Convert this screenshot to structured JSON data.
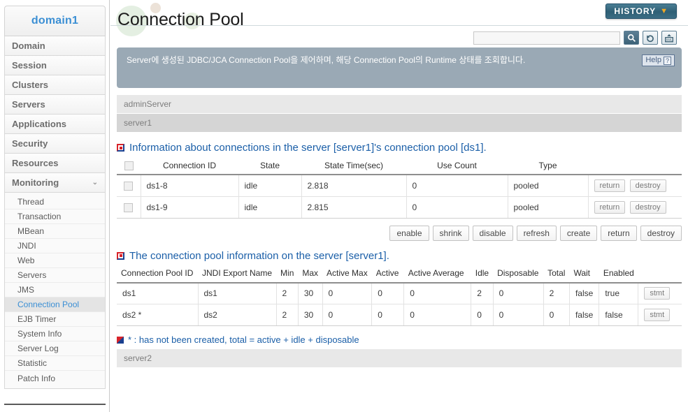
{
  "sidebar": {
    "brand": "domain1",
    "items": [
      {
        "label": "Domain"
      },
      {
        "label": "Session"
      },
      {
        "label": "Clusters"
      },
      {
        "label": "Servers"
      },
      {
        "label": "Applications"
      },
      {
        "label": "Security"
      },
      {
        "label": "Resources"
      },
      {
        "label": "Monitoring",
        "caret": "⌄",
        "expanded": true
      }
    ],
    "subitems": [
      {
        "label": "Thread",
        "active": false
      },
      {
        "label": "Transaction",
        "active": false
      },
      {
        "label": "MBean",
        "active": false
      },
      {
        "label": "JNDI",
        "active": false
      },
      {
        "label": "Web",
        "active": false
      },
      {
        "label": "Servers",
        "active": false
      },
      {
        "label": "JMS",
        "active": false
      },
      {
        "label": "Connection Pool",
        "active": true
      },
      {
        "label": "EJB Timer",
        "active": false
      },
      {
        "label": "System Info",
        "active": false
      },
      {
        "label": "Server Log",
        "active": false
      },
      {
        "label": "Statistic",
        "active": false
      },
      {
        "label": "Patch Info",
        "active": false
      }
    ]
  },
  "header": {
    "title": "Connection Pool",
    "history_label": "HISTORY",
    "history_caret": "▼",
    "search_value": "",
    "search_placeholder": "",
    "icons": [
      {
        "name": "search-icon",
        "glyph": "🔍"
      },
      {
        "name": "refresh-icon",
        "glyph": "↻"
      },
      {
        "name": "xml-export-icon",
        "glyph": "XML"
      }
    ]
  },
  "banner": {
    "text": "Server에 생성된 JDBC/JCA Connection Pool을 제어하며, 해당 Connection Pool의 Runtime 상태를 조회합니다.",
    "help_label": "Help",
    "help_mark": "?",
    "bg_color": "#9aa9b5"
  },
  "servers": [
    {
      "name": "adminServer",
      "state": "collapsed"
    },
    {
      "name": "server1",
      "state": "expanded"
    }
  ],
  "server2_bar": {
    "name": "server2",
    "state": "collapsed"
  },
  "section1": {
    "heading": "Information about connections in the server [server1]'s connection pool [ds1].",
    "columns": [
      "",
      "Connection ID",
      "State",
      "State Time(sec)",
      "Use Count",
      "Type",
      ""
    ],
    "rows": [
      {
        "connection_id": "ds1-8",
        "state": "idle",
        "state_time": "2.818",
        "use_count": "0",
        "type": "pooled",
        "actions": [
          "return",
          "destroy"
        ]
      },
      {
        "connection_id": "ds1-9",
        "state": "idle",
        "state_time": "2.815",
        "use_count": "0",
        "type": "pooled",
        "actions": [
          "return",
          "destroy"
        ]
      }
    ]
  },
  "action_buttons": [
    "enable",
    "shrink",
    "disable",
    "refresh",
    "create",
    "return",
    "destroy"
  ],
  "section2": {
    "heading": "The connection pool information on the server [server1].",
    "columns": [
      "Connection Pool ID",
      "JNDI Export Name",
      "Min",
      "Max",
      "Active Max",
      "Active",
      "Active Average",
      "Idle",
      "Disposable",
      "Total",
      "Wait",
      "Enabled",
      ""
    ],
    "rows": [
      {
        "pool_id": "ds1",
        "jndi": "ds1",
        "min": "2",
        "max": "30",
        "active_max": "0",
        "active": "0",
        "active_avg": "0",
        "idle": "2",
        "disposable": "0",
        "total": "2",
        "wait": "false",
        "enabled": "true",
        "action": "stmt"
      },
      {
        "pool_id": "ds2 *",
        "jndi": "ds2",
        "min": "2",
        "max": "30",
        "active_max": "0",
        "active": "0",
        "active_avg": "0",
        "idle": "0",
        "disposable": "0",
        "total": "0",
        "wait": "false",
        "enabled": "false",
        "action": "stmt"
      }
    ]
  },
  "footnote": {
    "text": "* : has not been created, total = active + idle + disposable"
  },
  "colors": {
    "accent_blue": "#1b5fa8",
    "link_blue": "#3b8fd4",
    "banner_gray": "#9aa9b5",
    "history_teal": "#2f5f75",
    "history_caret_orange": "#f0a825"
  }
}
